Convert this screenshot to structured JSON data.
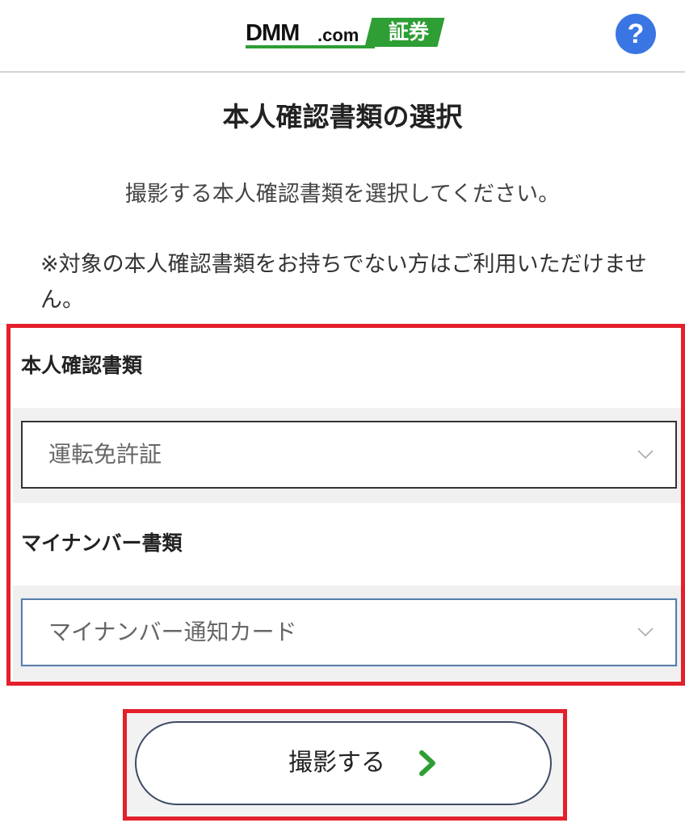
{
  "header": {
    "logo": {
      "brand": "DMM",
      "domain": ".com",
      "badge": "証券",
      "brand_color": "#2e9e35"
    },
    "help_label": "?",
    "help_color": "#3a76e3"
  },
  "page_title": "本人確認書類の選択",
  "instruction": "撮影する本人確認書類を選択してください。",
  "notice": "※対象の本人確認書類をお持ちでない方はご利用いただけません。",
  "form": {
    "id_document": {
      "label": "本人確認書類",
      "selected": "運転免許証",
      "icon": "chevron-down-icon"
    },
    "my_number_document": {
      "label": "マイナンバー書類",
      "selected": "マイナンバー通知カード",
      "icon": "chevron-down-icon"
    }
  },
  "shoot_button": {
    "label": "撮影する",
    "icon": "chevron-right-icon",
    "arrow_color": "#2e9e35"
  },
  "highlight_color": "#e3202b"
}
